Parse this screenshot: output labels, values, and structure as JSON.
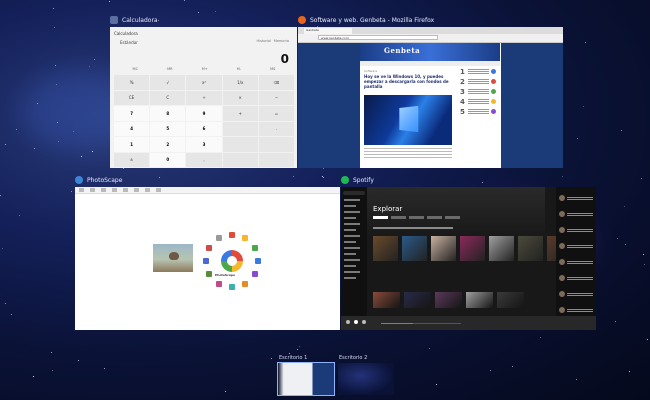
{
  "windows": {
    "calculator": {
      "title": "Calculadora",
      "mode": "Estándar",
      "history_label": "Historial",
      "memory_tab": "Memoria",
      "display": "0",
      "memory_keys": [
        "MC",
        "MR",
        "M+",
        "M-",
        "MS"
      ],
      "keys": [
        "%",
        "√",
        "x²",
        "1/x",
        "⌫",
        "CE",
        "C",
        "÷",
        "×",
        "−",
        "7",
        "8",
        "9",
        "+",
        "=",
        "4",
        "5",
        "6",
        "",
        ".",
        "1",
        "2",
        "3",
        "",
        "",
        "±",
        "0",
        ",",
        "",
        ""
      ]
    },
    "firefox": {
      "title": "Software y web. Genbeta - Mozilla Firefox",
      "tab": "Genbeta",
      "url": "www.genbeta.com",
      "site_logo": "Genbeta",
      "tag": "Software",
      "headline": "Hoy se ve la Windows 10, y puedes empezar a descargarla con fondos de pantalla",
      "ranking": [
        "1",
        "2",
        "3",
        "4",
        "5"
      ]
    },
    "photoscape": {
      "title": "PhotoScape",
      "brand": "PhotoScape"
    },
    "spotify": {
      "title": "Spotify",
      "heading": "Explorar"
    }
  },
  "desktops": [
    "Escritorio 1",
    "Escritorio 2"
  ],
  "colors": {
    "firefox_icon": "#e8661a",
    "photoscape_icon": "#3a86d8",
    "spotify_icon": "#1db954",
    "calculator_icon": "#5b6fa0",
    "selection": "#8fb2ff"
  }
}
